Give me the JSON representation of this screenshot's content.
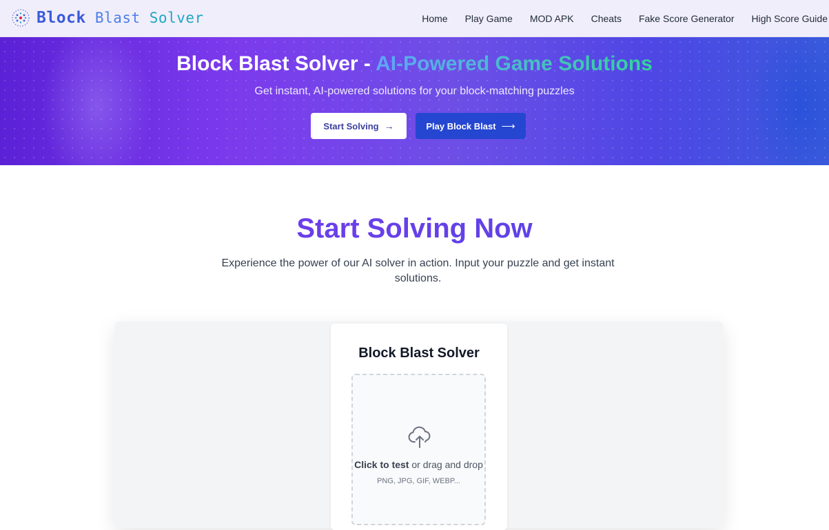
{
  "brand": {
    "name_block": "Block",
    "name_blast": "Blast",
    "name_solver": "Solver",
    "icon": "dotted-circle-logo-icon"
  },
  "nav": {
    "items": [
      {
        "label": "Home"
      },
      {
        "label": "Play Game"
      },
      {
        "label": "MOD APK"
      },
      {
        "label": "Cheats"
      },
      {
        "label": "Fake Score Generator"
      },
      {
        "label": "High Score Guide"
      }
    ]
  },
  "hero": {
    "title_main": "Block Blast Solver - ",
    "title_accent": "AI-Powered Game Solutions",
    "subtitle": "Get instant, AI-powered solutions for your block-matching puzzles",
    "start_button": "Start Solving",
    "start_arrow": "→",
    "play_button": "Play Block Blast",
    "play_arrow": "⟶"
  },
  "section": {
    "title": "Start Solving Now",
    "description": "Experience the power of our AI solver in action. Input your puzzle and get instant solutions."
  },
  "solver": {
    "title": "Block Blast Solver",
    "upload_icon": "cloud-upload-icon",
    "click_text": "Click to test",
    "drag_text": " or drag and drop",
    "formats": "PNG, JPG, GIF, WEBP..."
  },
  "colors": {
    "hero_start": "#5b21d6",
    "hero_end": "#3b5bdb",
    "accent_blue": "#60a5fa",
    "accent_green": "#34d399",
    "play_button": "#2546d1",
    "title_purple": "#7c3aed"
  }
}
